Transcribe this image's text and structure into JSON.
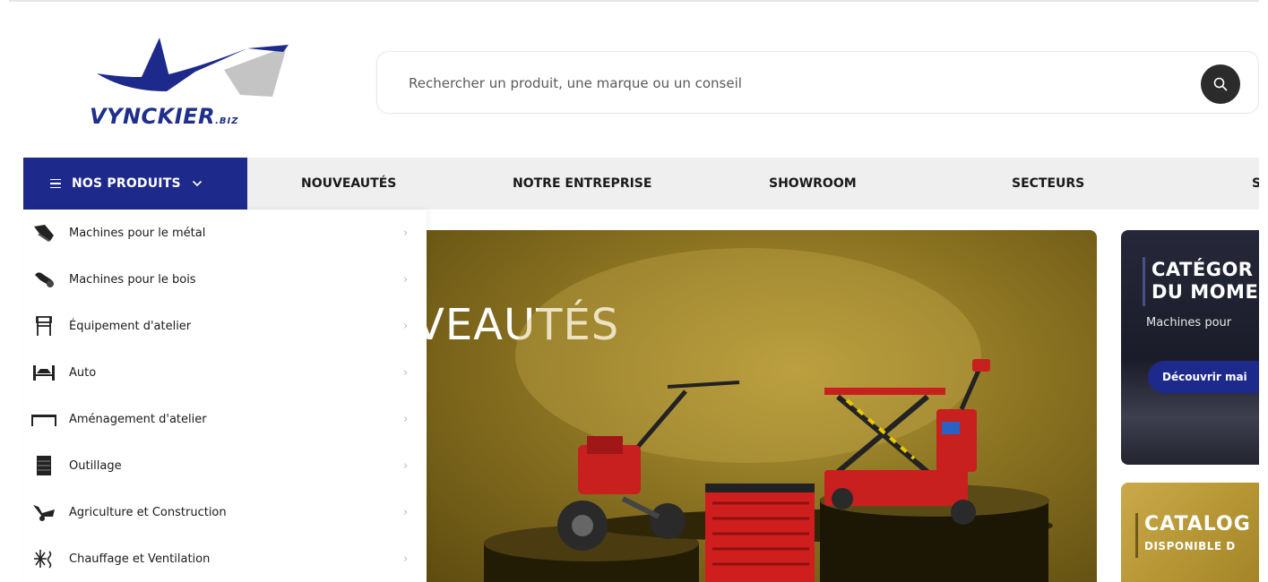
{
  "brand": {
    "name": "VYNCKIER",
    "suffix": ".BIZ",
    "colors": {
      "blue": "#1d2a8c",
      "grey": "#c4c4c4"
    }
  },
  "search": {
    "placeholder": "Rechercher un produit, une marque ou un conseil",
    "button_icon": "search-icon"
  },
  "nav": {
    "products_label": "NOS PRODUITS",
    "products_icon": "menu-icon",
    "products_chevron": "chevron-down-icon",
    "items": [
      {
        "label": "NOUVEAUTÉS"
      },
      {
        "label": "NOTRE ENTREPRISE"
      },
      {
        "label": "SHOWROOM"
      },
      {
        "label": "SECTEURS"
      },
      {
        "label": "SE"
      }
    ]
  },
  "menu": {
    "items": [
      {
        "label": "Machines pour le métal",
        "icon": "metal-machine-icon"
      },
      {
        "label": "Machines pour le bois",
        "icon": "wood-log-icon"
      },
      {
        "label": "Équipement d'atelier",
        "icon": "workbench-icon"
      },
      {
        "label": "Auto",
        "icon": "car-lift-icon"
      },
      {
        "label": "Aménagement d'atelier",
        "icon": "workshop-table-icon"
      },
      {
        "label": "Outillage",
        "icon": "tool-cabinet-icon"
      },
      {
        "label": "Agriculture et Construction",
        "icon": "wheelbarrow-icon"
      },
      {
        "label": "Chauffage et Ventilation",
        "icon": "snowflake-heat-icon"
      }
    ],
    "chevron": "›"
  },
  "hero": {
    "title": "VEAUTÉS",
    "background": "#8c7422"
  },
  "side_cards": {
    "category": {
      "title_line1": "CATÉGOR",
      "title_line2": "DU MOME",
      "subtitle": "Machines pour",
      "button": "Découvrir mai"
    },
    "catalog": {
      "title": "CATALOG",
      "subtitle": "DISPONIBLE D"
    }
  }
}
